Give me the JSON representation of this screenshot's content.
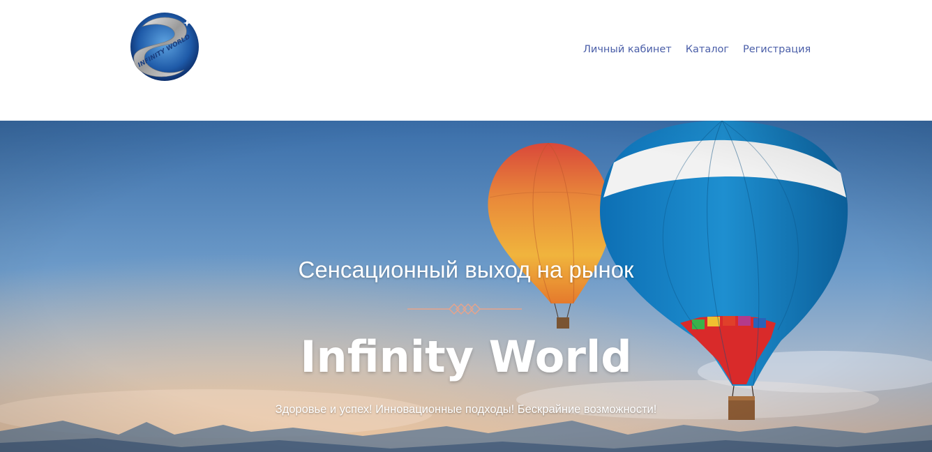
{
  "header": {
    "logo_text": "INFINITY WORLD",
    "nav": [
      {
        "label": "Личный кабинет"
      },
      {
        "label": "Каталог"
      },
      {
        "label": "Регистрация"
      }
    ]
  },
  "hero": {
    "subtitle": "Сенсационный выход на рынок",
    "title": "Infinity World",
    "tagline": "Здоровье и успех! Инновационные подходы! Бескрайние возможности!"
  },
  "colors": {
    "nav_link": "#4a5ea8",
    "divider": "#e8a38a",
    "sky_top": "#3f72ad",
    "sky_bottom": "#c9b9b3"
  }
}
